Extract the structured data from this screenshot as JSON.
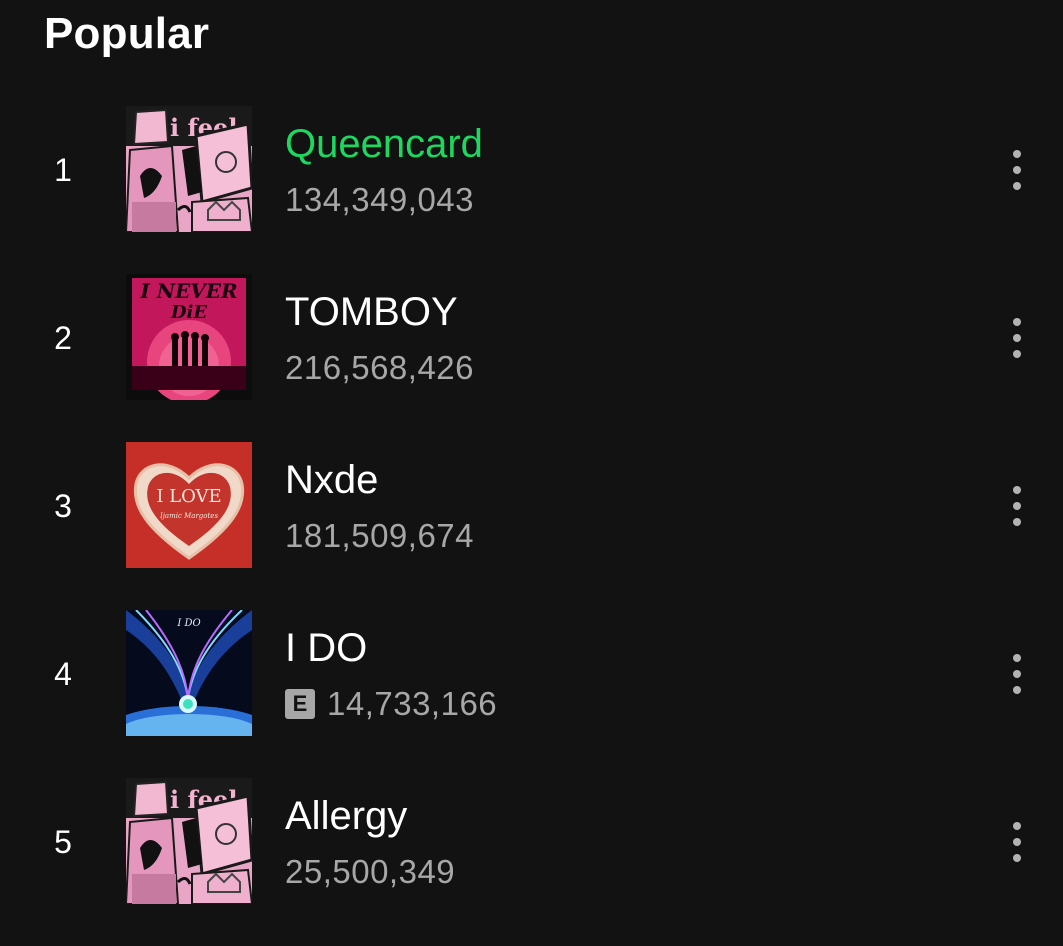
{
  "section": {
    "title": "Popular"
  },
  "colors": {
    "background": "#121212",
    "active_title": "#1ed760",
    "secondary_text": "#a7a7a7"
  },
  "tracks": [
    {
      "index": "1",
      "title": "Queencard",
      "plays": "134,349,043",
      "explicit": false,
      "active": true,
      "cover": "i-feel-cover"
    },
    {
      "index": "2",
      "title": "TOMBOY",
      "plays": "216,568,426",
      "explicit": false,
      "active": false,
      "cover": "i-never-die-cover"
    },
    {
      "index": "3",
      "title": "Nxde",
      "plays": "181,509,674",
      "explicit": false,
      "active": false,
      "cover": "i-love-cover"
    },
    {
      "index": "4",
      "title": "I DO",
      "plays": "14,733,166",
      "explicit": true,
      "explicit_label": "E",
      "active": false,
      "cover": "i-do-cover"
    },
    {
      "index": "5",
      "title": "Allergy",
      "plays": "25,500,349",
      "explicit": false,
      "active": false,
      "cover": "i-feel-cover"
    }
  ],
  "icons": {
    "more": "more-options-icon"
  }
}
